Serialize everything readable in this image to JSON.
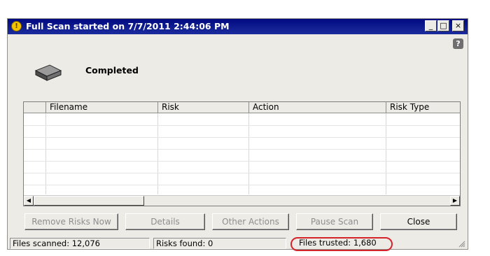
{
  "window": {
    "title": "Full Scan started on 7/7/2011 2:44:06 PM",
    "controls": {
      "minimize": "_",
      "maximize": "□",
      "close": "×"
    }
  },
  "status": {
    "label": "Completed",
    "icon": "drive-icon"
  },
  "table": {
    "columns": [
      "",
      "Filename",
      "Risk",
      "Action",
      "Risk Type"
    ]
  },
  "buttons": {
    "remove_risks": "Remove Risks Now",
    "details": "Details",
    "other_actions": "Other Actions",
    "pause_scan": "Pause Scan",
    "close": "Close"
  },
  "statusbar": {
    "files_scanned": "Files scanned: 12,076",
    "risks_found": "Risks found: 0",
    "files_trusted": "Files trusted: 1,680"
  },
  "colors": {
    "titlebar": "#000a80",
    "highlight": "#d5232b",
    "window_bg": "#ecebe6"
  }
}
